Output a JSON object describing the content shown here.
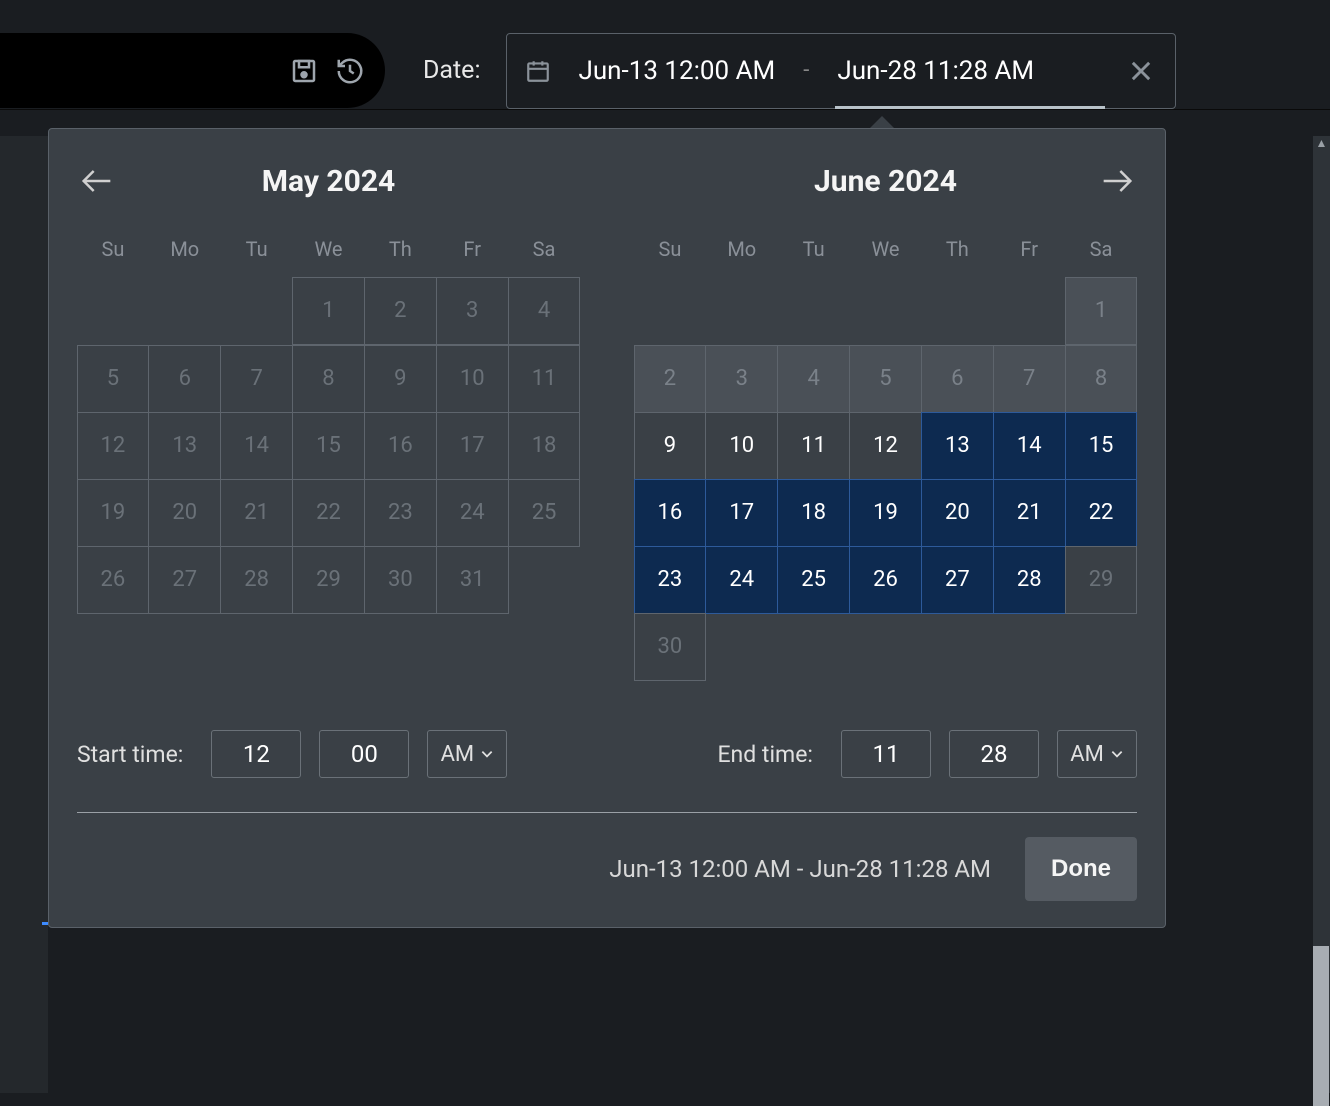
{
  "toolbar": {
    "date_label": "Date:",
    "start_display": "Jun-13 12:00 AM",
    "end_display": "Jun-28 11:28 AM",
    "range_sep": "-"
  },
  "calendar": {
    "left": {
      "title": "May 2024",
      "dow": [
        "Su",
        "Mo",
        "Tu",
        "We",
        "Th",
        "Fr",
        "Sa"
      ],
      "leading_blanks": 3,
      "days": 31,
      "all_disabled": true
    },
    "right": {
      "title": "June 2024",
      "dow": [
        "Su",
        "Mo",
        "Tu",
        "We",
        "Th",
        "Fr",
        "Sa"
      ],
      "leading_overflow": [
        1
      ],
      "overflow_row2": [
        2,
        3,
        4,
        5,
        6,
        7,
        8
      ],
      "days": 30,
      "enabled_from": 9,
      "selected_from": 13,
      "selected_to": 28
    }
  },
  "time": {
    "start_label": "Start time:",
    "start_hour": "12",
    "start_min": "00",
    "start_ampm": "AM",
    "end_label": "End time:",
    "end_hour": "11",
    "end_min": "28",
    "end_ampm": "AM"
  },
  "footer": {
    "summary": "Jun-13 12:00 AM - Jun-28 11:28 AM",
    "done": "Done"
  }
}
